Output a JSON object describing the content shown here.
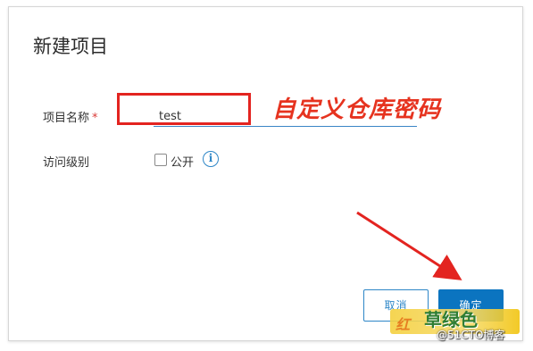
{
  "dialog": {
    "title": "新建项目",
    "fields": {
      "name": {
        "label": "项目名称",
        "required_mark": "*",
        "value": "test"
      },
      "access": {
        "label": "访问级别",
        "checkbox_label": "公开",
        "checked": false,
        "info_icon": "i"
      }
    },
    "buttons": {
      "cancel": "取消",
      "ok": "确定"
    }
  },
  "annotation": {
    "text": "自定义仓库密码",
    "color": "#e6331f"
  },
  "watermark": {
    "left_text": "红",
    "main_text": "草绿色",
    "sub_text": "@51CTO博客"
  },
  "colors": {
    "accent": "#0b74c0",
    "annotation_red": "#e32420"
  }
}
